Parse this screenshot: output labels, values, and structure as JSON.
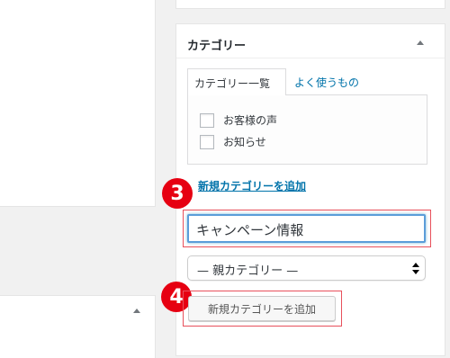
{
  "category_box": {
    "title": "カテゴリー",
    "tabs": [
      {
        "label": "カテゴリー一覧",
        "active": true
      },
      {
        "label": "よく使うもの",
        "active": false
      }
    ],
    "categories": [
      {
        "label": "お客様の声",
        "checked": false
      },
      {
        "label": "お知らせ",
        "checked": false
      }
    ],
    "add_new_link": "新規カテゴリーを追加",
    "new_category_value": "キャンペーン情報",
    "parent_select_value": "— 親カテゴリー —",
    "submit_label": "新規カテゴリーを追加"
  },
  "annotations": {
    "step_3": "3",
    "step_4": "4",
    "color": "#e60012"
  },
  "colors": {
    "link": "#0073aa",
    "focus_border": "#5b9dd9",
    "background": "#f1f1f1"
  }
}
